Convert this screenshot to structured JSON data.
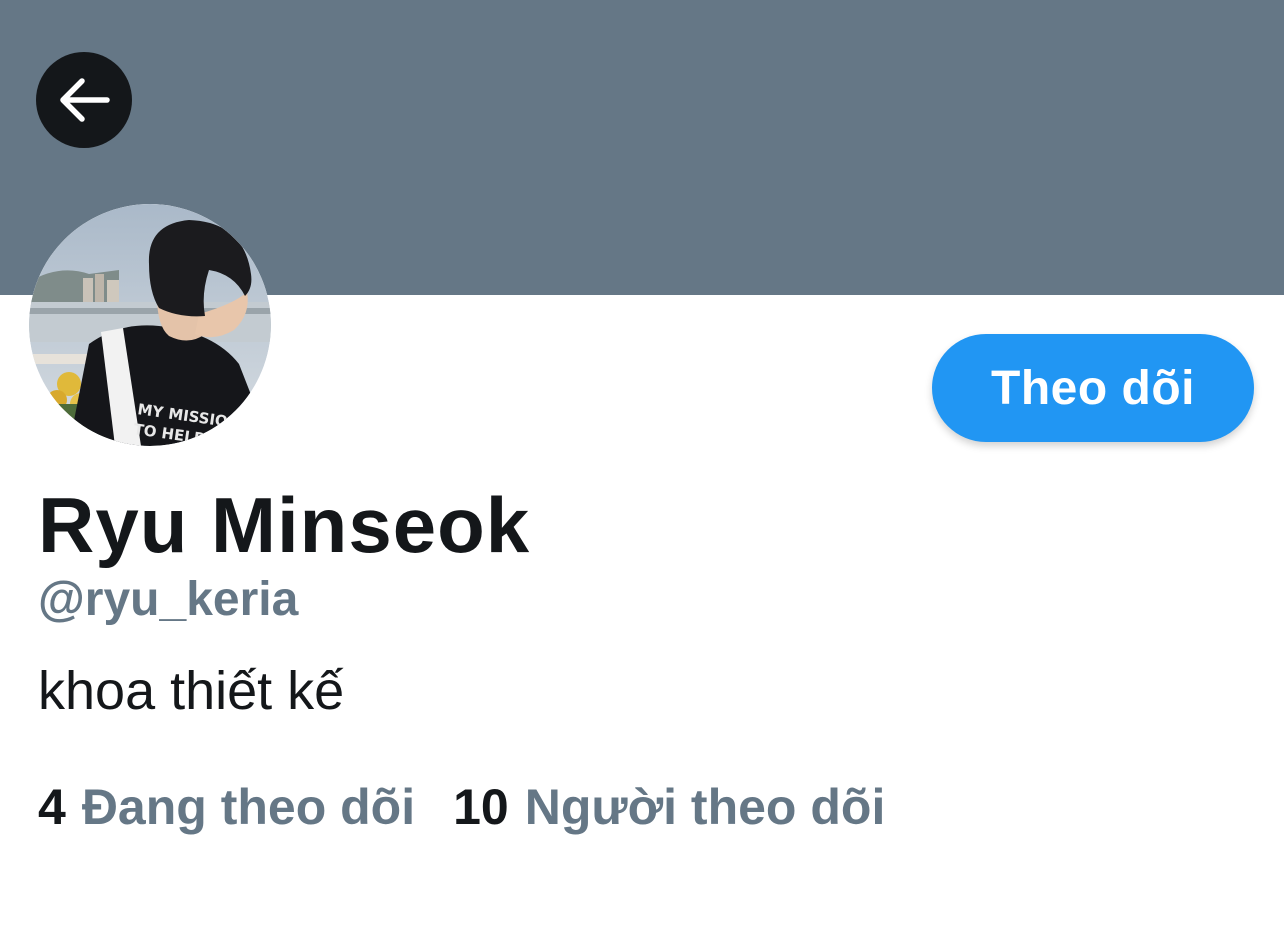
{
  "profile": {
    "display_name": "Ryu Minseok",
    "handle": "@ryu_keria",
    "bio": "khoa thiết kế",
    "follow_label": "Theo dõi"
  },
  "stats": {
    "following_count": "4",
    "following_label": "Đang theo dõi",
    "followers_count": "10",
    "followers_label": "Người theo dõi"
  },
  "icons": {
    "back": "arrow-left-icon"
  },
  "colors": {
    "banner": "#657786",
    "accent": "#2196f3",
    "text_primary": "#14171a",
    "text_secondary": "#657786"
  }
}
